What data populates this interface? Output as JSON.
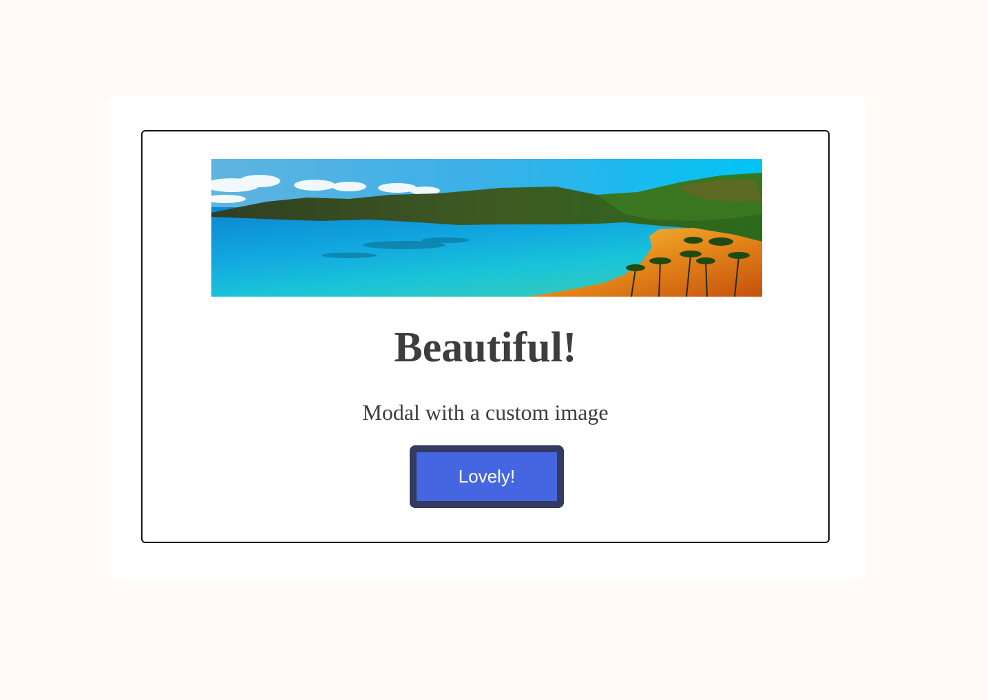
{
  "modal": {
    "image_alt": "Beach bay with turquoise water, green hills and palm trees",
    "title": "Beautiful!",
    "text": "Modal with a custom image",
    "confirm_label": "Lovely!"
  },
  "colors": {
    "page_background": "#fffaf6",
    "button_fill": "#4466e0",
    "button_border": "#343a60",
    "text": "#3d3d3d"
  }
}
